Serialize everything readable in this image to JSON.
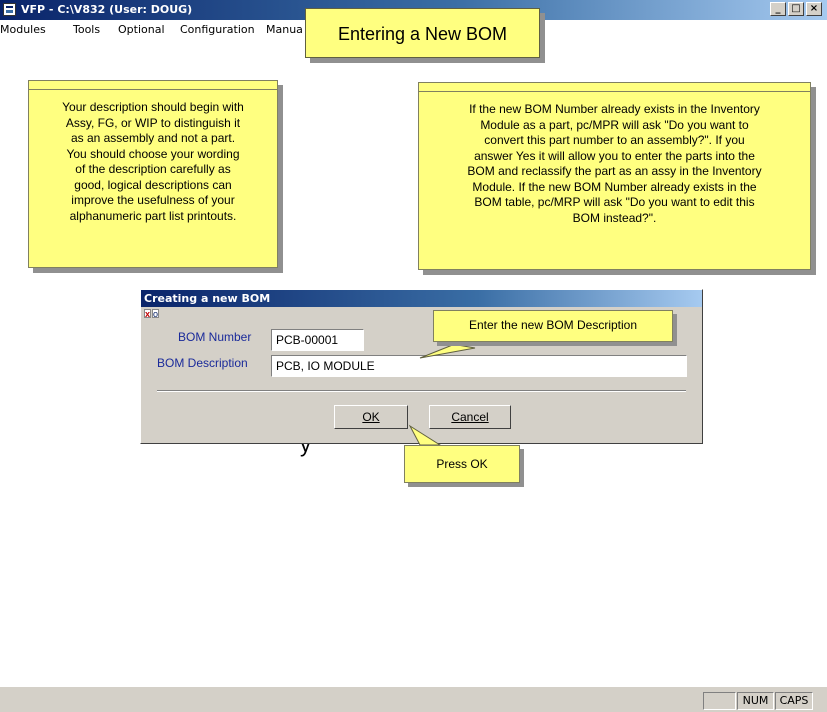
{
  "window": {
    "title": "VFP - C:\\V832  (User: DOUG)",
    "controls": [
      "_",
      "□",
      "×"
    ]
  },
  "menu": [
    "Modules",
    "Tools",
    "Optional",
    "Configuration",
    "Manua"
  ],
  "main_callout": "Entering a New BOM",
  "callouts": {
    "left_lines": [
      "Your description should begin with",
      "Assy, FG, or WIP to distinguish it",
      "as an assembly and not a part.",
      "You should choose your wording",
      "of the description carefully as",
      "good, logical descriptions can",
      "improve the usefulness of your",
      "alphanumeric part list printouts."
    ],
    "right_lines": [
      "If the new BOM Number already exists in the Inventory",
      "Module as a part, pc/MPR will ask \"Do you want to",
      "convert this part number to an assembly?\".  If you",
      "answer Yes it will allow you to enter the parts into the",
      "BOM and reclassify the part as an assy in the Inventory",
      "Module.   If the new BOM Number already exists in the",
      "BOM table, pc/MRP will ask \"Do you want to edit this",
      "BOM instead?\"."
    ],
    "description_hint": "Enter the new BOM Description",
    "ok_hint": "Press OK"
  },
  "dialog": {
    "title": "Creating a new BOM",
    "mini_icons": [
      "x",
      "o"
    ],
    "bom_number_label": "BOM Number",
    "bom_number_value": "PCB-00001",
    "bom_description_label": "BOM Description",
    "bom_description_value": "PCB, IO MODULE",
    "ok_label": "OK",
    "cancel_label": "Cancel"
  },
  "statusbar": {
    "num": "NUM",
    "caps": "CAPS"
  }
}
